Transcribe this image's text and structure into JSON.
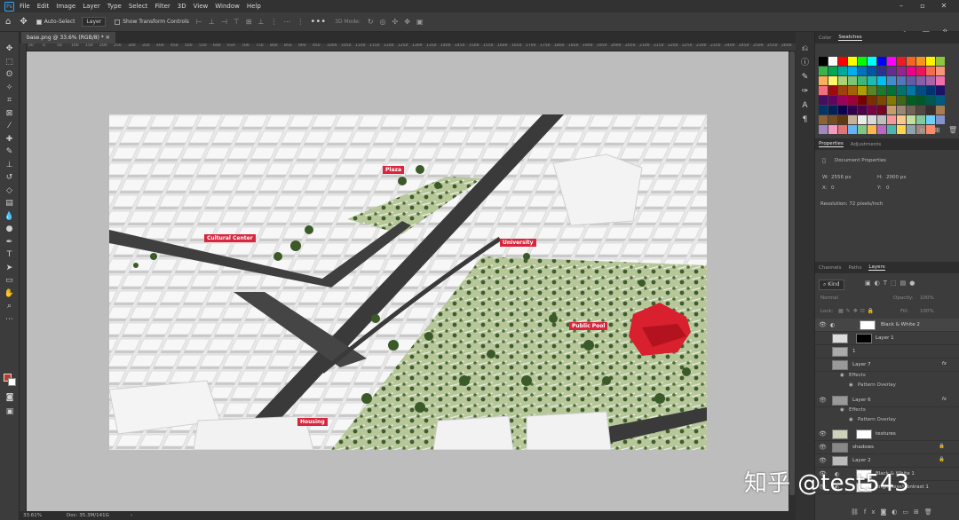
{
  "menubar": {
    "logo": "Ps",
    "items": [
      "File",
      "Edit",
      "Image",
      "Layer",
      "Type",
      "Select",
      "Filter",
      "3D",
      "View",
      "Window",
      "Help"
    ]
  },
  "options": {
    "auto_select_label": "Auto-Select",
    "auto_select_target": "Layer",
    "show_transform_label": "Show Transform Controls",
    "mode_3d_label": "3D Mode:"
  },
  "document": {
    "tab_title": "base.png @ 33.6% (RGB/8) *",
    "zoom": "33.61%",
    "doc_size": "Doc: 35.3M/141G"
  },
  "ruler_ticks": [
    "50",
    "0",
    "50",
    "100",
    "150",
    "200",
    "250",
    "300",
    "350",
    "400",
    "450",
    "500",
    "550",
    "600",
    "650",
    "700",
    "750",
    "800",
    "850",
    "900",
    "950",
    "1000",
    "1050",
    "1100",
    "1150",
    "1200",
    "1250",
    "1300",
    "1350",
    "1400",
    "1450",
    "1500",
    "1550",
    "1600",
    "1650",
    "1700",
    "1750",
    "1800",
    "1850",
    "1900",
    "1950",
    "2000",
    "2050",
    "2100",
    "2150",
    "2200",
    "2250",
    "2300",
    "2350",
    "2400",
    "2450",
    "2500",
    "2550",
    "2600"
  ],
  "map_labels": {
    "plaza": "Plaza",
    "cultural_center": "Cultural Center",
    "university": "University",
    "public_pool": "Public Pool",
    "housing": "Housing"
  },
  "color_panel": {
    "tabs": [
      "Color",
      "Swatches"
    ],
    "active": "Swatches",
    "swatches": [
      "#000000",
      "#ffffff",
      "#ff0000",
      "#ffff00",
      "#00ff00",
      "#00ffff",
      "#0000ff",
      "#ff00ff",
      "#ed1c24",
      "#f26522",
      "#f7941d",
      "#fff200",
      "#8dc63f",
      "#39b54a",
      "#00a651",
      "#00a99d",
      "#00aeef",
      "#0072bc",
      "#0054a6",
      "#2e3192",
      "#662d91",
      "#92278f",
      "#ec008c",
      "#ed145b",
      "#f26c4f",
      "#f69679",
      "#fbaf5d",
      "#fff568",
      "#acd373",
      "#7cc576",
      "#3cb878",
      "#1cbbb4",
      "#00bff3",
      "#448ccb",
      "#5674b9",
      "#605ca8",
      "#8560a8",
      "#a864a8",
      "#f06eaa",
      "#f26d7d",
      "#9e0b0f",
      "#a0410d",
      "#a36209",
      "#aba000",
      "#598527",
      "#1a7b30",
      "#007236",
      "#00746b",
      "#0076a3",
      "#004b80",
      "#003471",
      "#1b1464",
      "#440e62",
      "#630460",
      "#9e005d",
      "#9e0039",
      "#790000",
      "#7b2e00",
      "#7d4900",
      "#827b00",
      "#406618",
      "#005e20",
      "#005826",
      "#005952",
      "#005b7f",
      "#003663",
      "#002157",
      "#0d004c",
      "#32004b",
      "#4b0049",
      "#7b0046",
      "#7a0026",
      "#c69c6d",
      "#998675",
      "#736357",
      "#534741",
      "#362f2d",
      "#a67c52",
      "#8c6239",
      "#754c24",
      "#603913",
      "#c7b299",
      "#ebebeb",
      "#d9d9d9",
      "#bfbfbf",
      "#f5989d",
      "#fdc68a",
      "#c4df9b",
      "#82ca9c",
      "#6dcff6",
      "#8493ca",
      "#a187be",
      "#f49ac1",
      "#e57373",
      "#64b5f6",
      "#81c784",
      "#ffb74d",
      "#ba68c8",
      "#4db6ac",
      "#ffd54f",
      "#90a4ae",
      "#a1887f",
      "#ff8a65"
    ]
  },
  "properties_panel": {
    "tabs": [
      "Properties",
      "Adjustments"
    ],
    "active": "Properties",
    "heading": "Document Properties",
    "w_label": "W:",
    "w_value": "2556 px",
    "h_label": "H:",
    "h_value": "2000 px",
    "x_label": "X:",
    "x_value": "0",
    "y_label": "Y:",
    "y_value": "0",
    "resolution": "Resolution: 72 pixels/inch"
  },
  "layers_panel": {
    "tabs": [
      "Channels",
      "Paths",
      "Layers"
    ],
    "active": "Layers",
    "kind_label": "Kind",
    "blend_mode": "Normal",
    "opacity_label": "Opacity:",
    "opacity_value": "100%",
    "lock_label": "Lock:",
    "fill_label": "Fill:",
    "fill_value": "100%",
    "layers": [
      {
        "name": "Black & White 2",
        "fx": ""
      },
      {
        "name": "Layer 1",
        "fx": ""
      },
      {
        "name": "1",
        "fx": ""
      },
      {
        "name": "Layer 7",
        "fx": "fx"
      },
      {
        "name": "Layer 6",
        "fx": "fx"
      },
      {
        "name": "textures",
        "fx": ""
      },
      {
        "name": "shadows",
        "fx": ""
      },
      {
        "name": "Layer 2",
        "fx": ""
      },
      {
        "name": "Black & White 1",
        "fx": ""
      },
      {
        "name": "Brightness/Contrast 1",
        "fx": ""
      }
    ],
    "effects_label": "Effects",
    "pattern_overlay_label": "Pattern Overlay"
  },
  "watermark": "知乎 @test543"
}
